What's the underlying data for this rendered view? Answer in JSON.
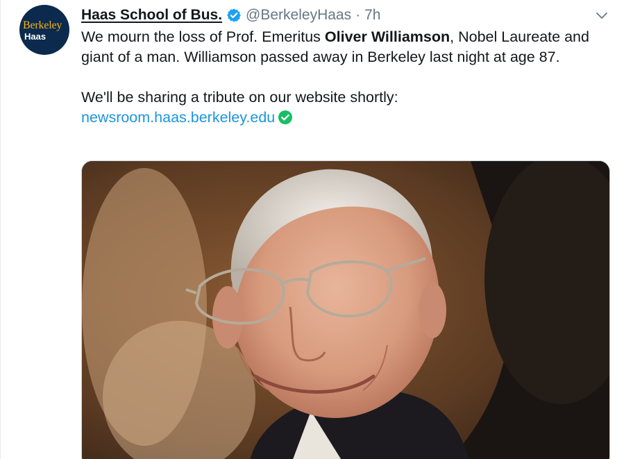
{
  "account": {
    "avatar_line1": "Berkeley",
    "avatar_line2": "Haas",
    "display_name": "Haas School of Bus.",
    "handle": "@BerkeleyHaas",
    "separator": "·",
    "time_ago": "7h",
    "verified": true
  },
  "tweet": {
    "line1_pre": "We mourn the loss of Prof. Emeritus ",
    "line1_bold": "Oliver Williamson",
    "line1_post": ", Nobel Laureate and giant of a man. Williamson passed away in Berkeley last night at age 87.",
    "line2": "We'll be sharing a tribute on our website shortly:",
    "link_text": "newsroom.haas.berkeley.edu"
  },
  "icons": {
    "verified": "verified-badge-icon",
    "more": "chevron-down-icon",
    "link_check": "check-circle-icon"
  },
  "colors": {
    "link": "#1b95e0",
    "verified": "#1da1f2",
    "check": "#17bf63",
    "muted": "#657786"
  }
}
